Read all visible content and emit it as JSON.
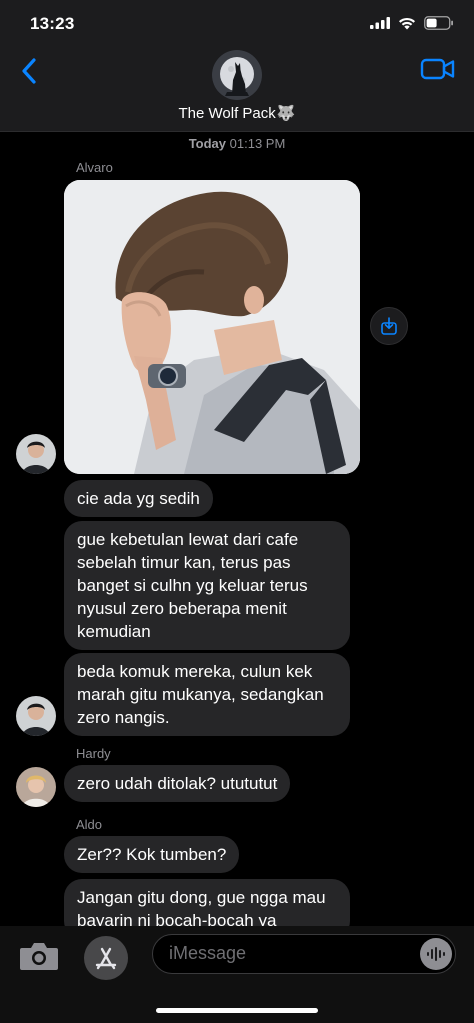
{
  "status_bar": {
    "time": "13:23"
  },
  "header": {
    "group_name": "The Wolf Pack",
    "group_emoji": "🐺"
  },
  "chat": {
    "timestamp_day": "Today",
    "timestamp_time": "01:13 PM",
    "senders": {
      "alvaro": "Alvaro",
      "hardy": "Hardy",
      "aldo": "Aldo"
    },
    "messages": [
      {
        "text": "cie ada yg sedih"
      },
      {
        "text": "gue kebetulan lewat dari cafe sebelah timur kan, terus pas banget si culhn yg keluar terus nyusul zero beberapa menit kemudian"
      },
      {
        "text": "beda komuk mereka, culun kek marah gitu mukanya, sedangkan zero nangis."
      },
      {
        "text": "zero udah ditolak? utututut"
      },
      {
        "text": "Zer?? Kok tumben?"
      },
      {
        "text": "Jangan gitu dong, gue ngga mau bayarin ni bocah-bocah ya"
      }
    ]
  },
  "input": {
    "placeholder": "iMessage"
  },
  "colors": {
    "accent": "#0a84ff",
    "bubble": "#262628",
    "background": "#000000"
  },
  "icons": [
    "back-chevron-icon",
    "video-call-icon",
    "share-icon",
    "camera-icon",
    "appstore-icon",
    "audio-waveform-icon"
  ]
}
